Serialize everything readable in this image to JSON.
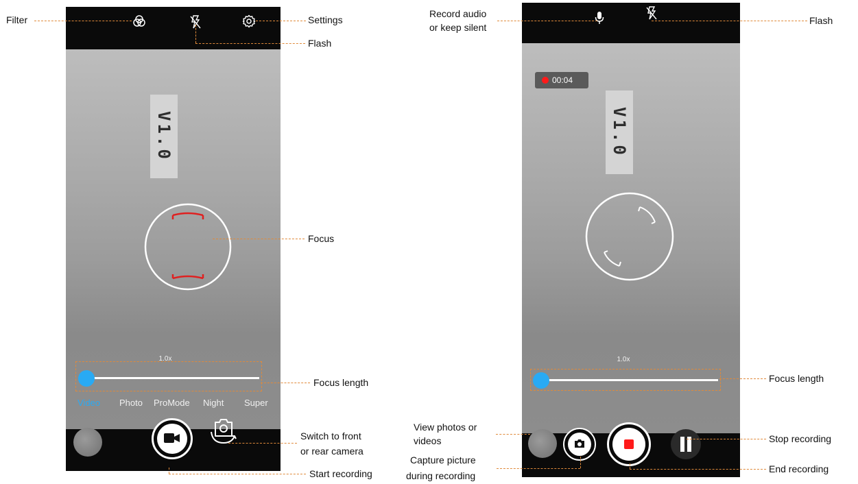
{
  "left_screen": {
    "zoom_label": "1.0x",
    "badge_text": "V1.0",
    "modes": [
      "Video",
      "Photo",
      "ProMode",
      "Night",
      "Super"
    ],
    "active_mode": "Video",
    "icons": {
      "filter": "filter-icon",
      "flash": "flash-off-icon",
      "settings": "gear-icon",
      "record": "video-camera-icon",
      "switch": "camera-switch-icon"
    }
  },
  "right_screen": {
    "zoom_label": "1.0x",
    "badge_text": "V1.0",
    "timer": "00:04",
    "icons": {
      "mic": "microphone-icon",
      "flash": "flash-off-icon",
      "capture": "camera-icon",
      "stop": "stop-icon",
      "pause": "pause-icon"
    }
  },
  "annotations": {
    "filter": "Filter",
    "settings": "Settings",
    "flash_left": "Flash",
    "focus": "Focus",
    "focus_length_left": "Focus length",
    "switch_camera_line1": "Switch to front",
    "switch_camera_line2": "or rear camera",
    "start_recording": "Start recording",
    "record_audio_line1": "Record audio",
    "record_audio_line2": "or keep silent",
    "flash_right": "Flash",
    "focus_length_right": "Focus length",
    "view_photos_line1": "View photos or",
    "view_photos_line2": "videos",
    "capture_line1": "Capture picture",
    "capture_line2": "during recording",
    "stop_recording": "Stop recording",
    "end_recording": "End recording"
  },
  "colors": {
    "accent_blue": "#29aaf4",
    "record_red": "#ff1a1a",
    "focus_red": "#e02020",
    "annotation_orange": "#e08a3a"
  }
}
